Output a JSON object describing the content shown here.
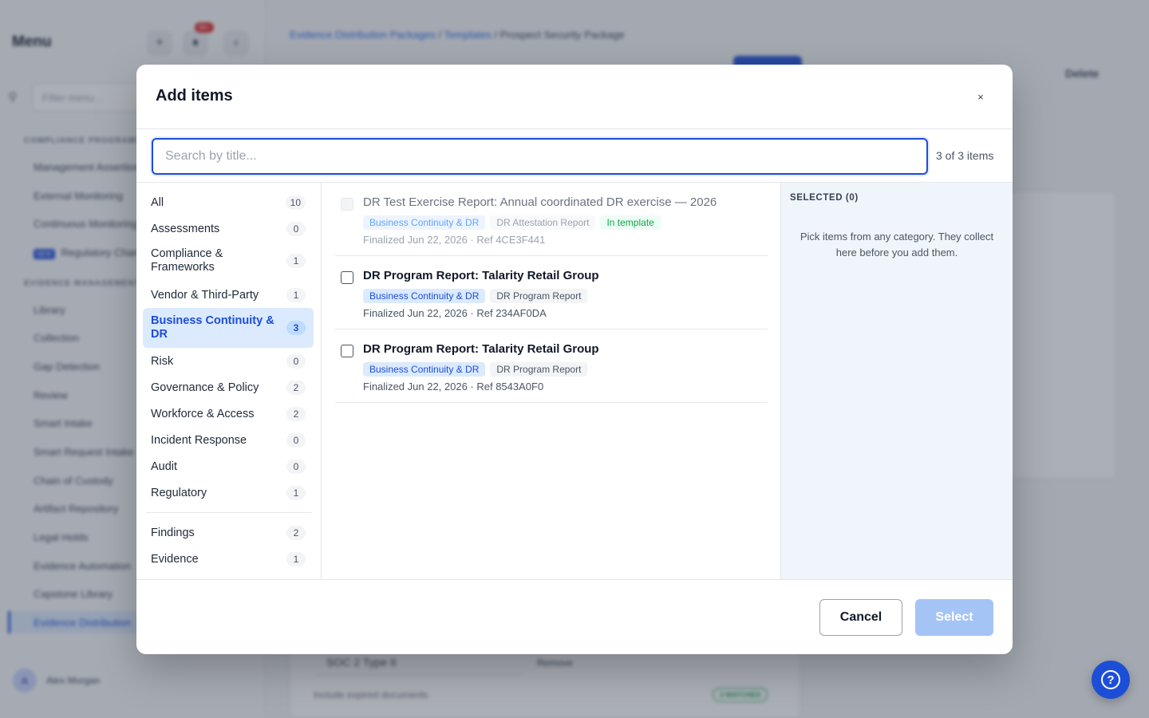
{
  "background": {
    "menu_title": "Menu",
    "notification_badge": "99+",
    "filter_placeholder": "Filter menu...",
    "section_compliance": "COMPLIANCE PROGRAMS",
    "compliance_items": [
      "Management Assertions",
      "External Monitoring",
      "Continuous Monitoring"
    ],
    "new_badge": "NEW",
    "regulatory_item": "Regulatory Change",
    "section_evidence": "EVIDENCE MANAGEMENT",
    "evidence_items": [
      "Library",
      "Collection",
      "Gap Detection",
      "Review",
      "Smart Intake",
      "Smart Request Intake",
      "Chain of Custody",
      "Artifact Repository",
      "Legal Holds",
      "Evidence Automation",
      "Capstone Library",
      "Evidence Distribution"
    ],
    "user_initial": "A",
    "user_name": "Alex Morgan",
    "breadcrumb": [
      "Evidence Distribution Packages",
      "Templates",
      "Prospect Security Package"
    ],
    "breadcrumb_sep": "/",
    "delete_label": "Delete",
    "select_value": "SOC 2 Type II",
    "remove_label": "Remove",
    "include_label": "Include expired documents",
    "matches_label": "2 MATCHES"
  },
  "modal": {
    "title": "Add items",
    "close_icon": "×",
    "search_placeholder": "Search by title...",
    "count_label": "3 of 3 items",
    "categories": [
      {
        "label": "All",
        "count": "10"
      },
      {
        "label": "Assessments",
        "count": "0"
      },
      {
        "label": "Compliance & Frameworks",
        "count": "1"
      },
      {
        "label": "Vendor & Third-Party",
        "count": "1"
      },
      {
        "label": "Business Continuity & DR",
        "count": "3"
      },
      {
        "label": "Risk",
        "count": "0"
      },
      {
        "label": "Governance & Policy",
        "count": "2"
      },
      {
        "label": "Workforce & Access",
        "count": "2"
      },
      {
        "label": "Incident Response",
        "count": "0"
      },
      {
        "label": "Audit",
        "count": "0"
      },
      {
        "label": "Regulatory",
        "count": "1"
      },
      {
        "label": "Findings",
        "count": "2"
      },
      {
        "label": "Evidence",
        "count": "1"
      }
    ],
    "items": [
      {
        "title": "DR Test Exercise Report: Annual coordinated DR exercise — 2026",
        "tag_category": "Business Continuity & DR",
        "tag_type": "DR Attestation Report",
        "tag_status": "In template",
        "meta": "Finalized Jun 22, 2026 · Ref 4CE3F441"
      },
      {
        "title": "DR Program Report: Talarity Retail Group",
        "tag_category": "Business Continuity & DR",
        "tag_type": "DR Program Report",
        "meta": "Finalized Jun 22, 2026 · Ref 234AF0DA"
      },
      {
        "title": "DR Program Report: Talarity Retail Group",
        "tag_category": "Business Continuity & DR",
        "tag_type": "DR Program Report",
        "meta": "Finalized Jun 22, 2026 · Ref 8543A0F0"
      }
    ],
    "selected_heading": "SELECTED (0)",
    "selected_empty": "Pick items from any category. They collect here before you add them.",
    "cancel_label": "Cancel",
    "select_label": "Select"
  },
  "help_icon": "?",
  "colors": {
    "accent": "#1d4ed8",
    "active_bg": "#dbeafe",
    "select_disabled": "#a5c4f6",
    "in_template": "#16a34a"
  }
}
